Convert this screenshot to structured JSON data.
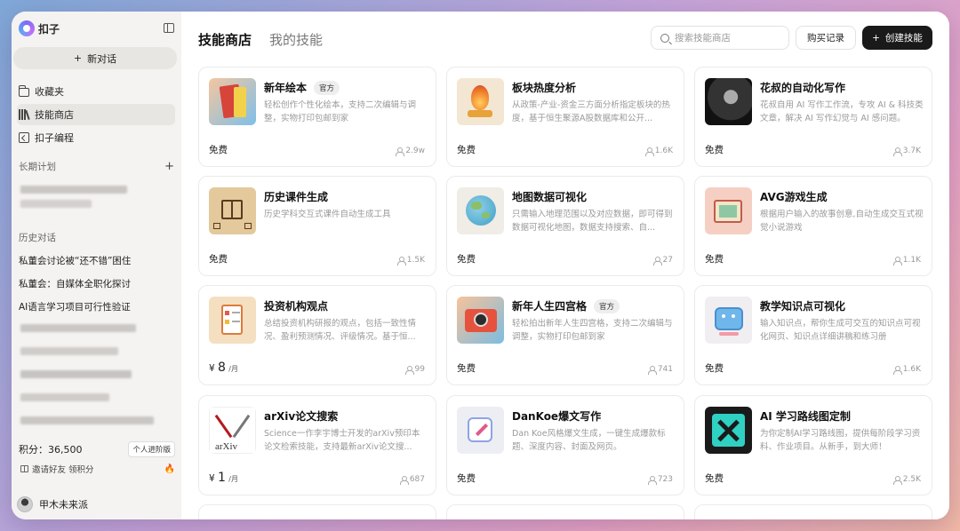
{
  "app": {
    "name": "扣子"
  },
  "sidebar": {
    "new_chat_label": "新对话",
    "nav": [
      {
        "label": "收藏夹",
        "icon": "folder-icon"
      },
      {
        "label": "技能商店",
        "icon": "store-icon"
      },
      {
        "label": "扣子编程",
        "icon": "code-icon"
      }
    ],
    "long_term_label": "长期计划",
    "history_label": "历史对话",
    "history": [
      "私董会讨论被“还不错”困住",
      "私董会：自媒体全职化探讨",
      "AI语言学习项目可行性验证"
    ],
    "points_label": "积分：36,500",
    "enterprise_label": "个人进阶版",
    "invite_label": "邀请好友 领积分",
    "user_name": "甲木未来派"
  },
  "header": {
    "tabs": [
      "技能商店",
      "我的技能"
    ],
    "search_placeholder": "搜索技能商店",
    "record_label": "购买记录",
    "create_label": "创建技能"
  },
  "cards": [
    {
      "title": "新年绘本",
      "badge": "官方",
      "desc": "轻松创作个性化绘本，支持二次编辑与调整，实物打印包邮到家",
      "price": "免费",
      "users": "2.9w",
      "thumb": "book"
    },
    {
      "title": "板块热度分析",
      "badge": "",
      "desc": "从政策-产业-资金三方面分析指定板块的热度，基于恒生聚源A股数据库和公开...",
      "price": "免费",
      "users": "1.6K",
      "thumb": "fire"
    },
    {
      "title": "花叔的自动化写作",
      "badge": "",
      "desc": "花叔自用 AI 写作工作流，专攻 AI & 科技类文章，解决 AI 写作幻觉与 AI 感问题。",
      "price": "免费",
      "users": "3.7K",
      "thumb": "portrait"
    },
    {
      "title": "历史课件生成",
      "badge": "",
      "desc": "历史学科交互式课件自动生成工具",
      "price": "免费",
      "users": "1.5K",
      "thumb": "history"
    },
    {
      "title": "地图数据可视化",
      "badge": "",
      "desc": "只需输入地理范围以及对应数据，即可得到数据可视化地图，数据支持搜索、自...",
      "price": "免费",
      "users": "27",
      "thumb": "globe"
    },
    {
      "title": "AVG游戏生成",
      "badge": "",
      "desc": "根据用户输入的故事创意,自动生成交互式视觉小说游戏",
      "price": "免费",
      "users": "1.1K",
      "thumb": "game"
    },
    {
      "title": "投资机构观点",
      "badge": "",
      "desc": "总结投资机构研报的观点，包括一致性情况、盈利预测情况、评级情况。基于恒...",
      "price_symbol": "¥",
      "price_value": "8",
      "price_unit": "/月",
      "users": "99",
      "thumb": "report"
    },
    {
      "title": "新年人生四宫格",
      "badge": "官方",
      "desc": "轻松拍出新年人生四宫格，支持二次编辑与调整，实物打印包邮到家",
      "price": "免费",
      "users": "741",
      "thumb": "camera"
    },
    {
      "title": "教学知识点可视化",
      "badge": "",
      "desc": "输入知识点，帮你生成可交互的知识点可视化网页、知识点详细讲稿和练习册",
      "price": "免费",
      "users": "1.6K",
      "thumb": "tv"
    },
    {
      "title": "arXiv论文搜索",
      "badge": "",
      "desc": "Science一作李宇博士开发的arXiv预印本论文检索技能，支持最新arXiv论文搜...",
      "price_symbol": "¥",
      "price_value": "1",
      "price_unit": "/月",
      "users": "687",
      "thumb": "arxiv"
    },
    {
      "title": "DanKoe爆文写作",
      "badge": "",
      "desc": "Dan Koe风格爆文生成，一键生成爆款标题、深度内容、封面及网页。",
      "price": "免费",
      "users": "723",
      "thumb": "pen"
    },
    {
      "title": "AI 学习路线图定制",
      "badge": "",
      "desc": "为你定制AI学习路线图，提供每阶段学习资料、作业项目。从新手，到大师！",
      "price": "免费",
      "users": "2.5K",
      "thumb": "tools"
    }
  ],
  "colors": {
    "accent": "#1a1a1a",
    "sidebar_bg": "#f4f3f1"
  }
}
